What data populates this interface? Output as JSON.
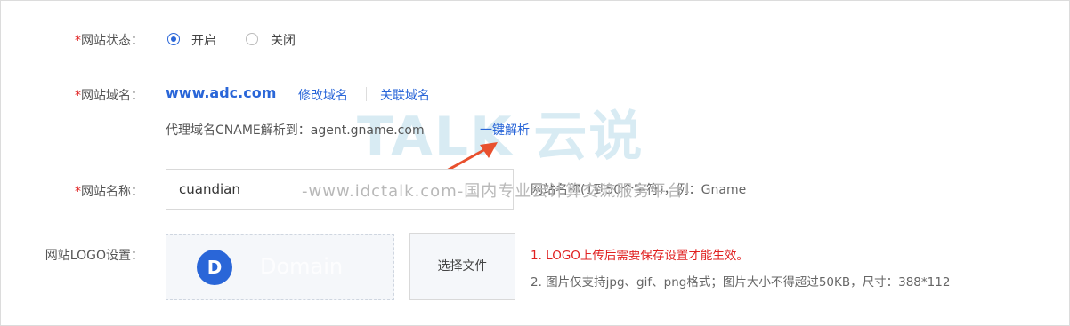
{
  "form": {
    "status": {
      "required_mark": "*",
      "label": "网站状态：",
      "options": [
        "开启",
        "关闭"
      ],
      "selected": "开启"
    },
    "domain": {
      "required_mark": "*",
      "label": "网站域名：",
      "value": "www.adc.com",
      "modify_link": "修改域名",
      "associate_link": "关联域名",
      "cname_text": "代理域名CNAME解析到：agent.gname.com",
      "one_click_link": "一键解析"
    },
    "name": {
      "required_mark": "*",
      "label": "网站名称：",
      "value": "cuandian",
      "hint": "网站名称(1到50个字符)，例：Gname"
    },
    "logo": {
      "label": "网站LOGO设置：",
      "preview_letter": "D",
      "preview_text": "Domain",
      "choose_button": "选择文件",
      "rule_1": "1. LOGO上传后需要保存设置才能生效。",
      "rule_2": "2. 图片仅支持jpg、gif、png格式；图片大小不得超过50KB，尺寸：388*112"
    }
  },
  "watermark": {
    "brand": "TALK 云说",
    "url_line": "-www.idctalk.com-国内专业云计算交流服务平台-"
  },
  "colors": {
    "accent": "#2a66d8",
    "required": "#e02020",
    "arrow": "#e8502e"
  }
}
